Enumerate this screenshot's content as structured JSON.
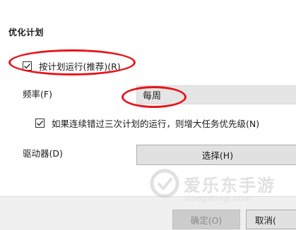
{
  "section": {
    "title": "优化计划"
  },
  "schedule": {
    "checked": true,
    "label": "按计划运行(推荐)(R)"
  },
  "frequency": {
    "label": "频率(F)",
    "value": "每周"
  },
  "priority": {
    "checked": true,
    "label": "如果连续错过三次计划的运行，则增大任务优先级(N)"
  },
  "drive": {
    "label": "驱动器(D)",
    "button_label": "选择(H)"
  },
  "footer": {
    "ok_label": "确定(O)",
    "cancel_label": "取消("
  },
  "watermark": {
    "text": "爱乐东手游",
    "subtext": "dongdong.com"
  },
  "colors": {
    "highlight_ellipse": "#e8141b",
    "checkmark": "#1a1a1a"
  }
}
